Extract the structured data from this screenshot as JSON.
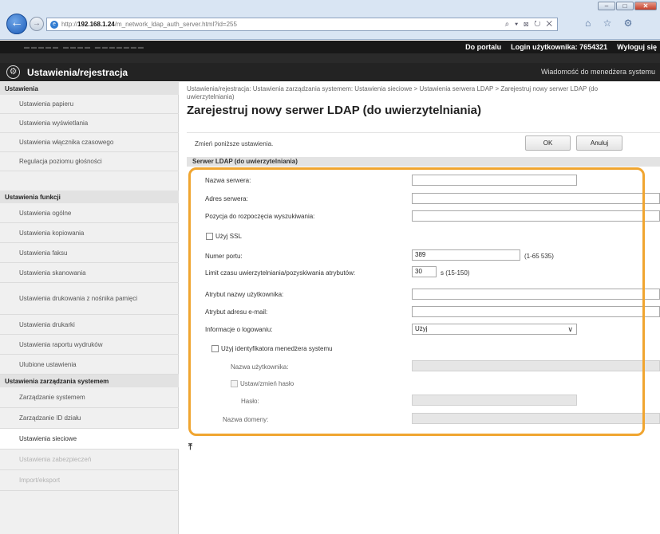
{
  "browser": {
    "url_prefix": "http://",
    "url_host": "192.168.1.24",
    "url_path": "/m_network_ldap_auth_server.html?id=255",
    "address_tools": "⌕ ▾ ⊠ ↻ ✕",
    "toolbar_icons": "⌂ ☆ ⚙",
    "window_controls": [
      "–",
      "□",
      "✕"
    ]
  },
  "header": {
    "portal_link": "Do portalu",
    "login_user": "Login użytkownika:  7654321",
    "logout": "Wyloguj się",
    "title": "Ustawienia/rejestracja",
    "admin_message": "Wiadomość do menedżera systemu"
  },
  "sidebar": {
    "sections": [
      {
        "title": "Ustawienia",
        "items": [
          "Ustawienia papieru",
          "Ustawienia wyświetlania",
          "Ustawienia włącznika czasowego",
          "Regulacja poziomu głośności"
        ]
      },
      {
        "title": "Ustawienia funkcji",
        "items": [
          "Ustawienia ogólne",
          "Ustawienia kopiowania",
          "Ustawienia faksu",
          "Ustawienia skanowania",
          "Ustawienia drukowania z nośnika pamięci",
          "Ustawienia drukarki",
          "Ustawienia raportu wydruków",
          "Ulubione ustawienia"
        ]
      },
      {
        "title": "Ustawienia zarządzania systemem",
        "items": [
          "Zarządzanie systemem",
          "Zarządzanie ID działu",
          "Ustawienia sieciowe",
          "Ustawienia zabezpieczeń",
          "Import/eksport"
        ]
      }
    ]
  },
  "main": {
    "breadcrumb": "Ustawienia/rejestracja: Ustawienia zarządzania systemem: Ustawienia sieciowe > Ustawienia serwera LDAP > Zarejestruj nowy serwer LDAP (do uwierzytelniania)",
    "title": "Zarejestruj nowy serwer LDAP (do uwierzytelniania)",
    "instruction": "Zmień poniższe ustawienia.",
    "ok_label": "OK",
    "cancel_label": "Anuluj",
    "section_title": "Serwer LDAP (do uwierzytelniania)",
    "top_icon": "⤒"
  },
  "form": {
    "server_name_label": "Nazwa serwera:",
    "server_name_value": "",
    "server_address_label": "Adres serwera:",
    "server_address_value": "",
    "search_start_label": "Pozycja do rozpoczęcia wyszukiwania:",
    "search_start_value": "",
    "use_ssl_label": "Użyj SSL",
    "port_label": "Numer portu:",
    "port_value": "389",
    "port_range": "(1-65 535)",
    "timeout_label": "Limit czasu uwierzytelniania/pozyskiwania atrybutów:",
    "timeout_value": "30",
    "timeout_range": "s (15-150)",
    "username_attr_label": "Atrybut nazwy użytkownika:",
    "username_attr_value": "",
    "email_attr_label": "Atrybut adresu e-mail:",
    "email_attr_value": "",
    "login_info_label": "Informacje o logowaniu:",
    "login_info_value": "Użyj",
    "use_admin_id_label": "Użyj identyfikatora menedżera systemu",
    "username_label": "Nazwa użytkownika:",
    "set_password_label": "Ustaw/zmień hasło",
    "password_label": "Hasło:",
    "domain_label": "Nazwa domeny:"
  }
}
